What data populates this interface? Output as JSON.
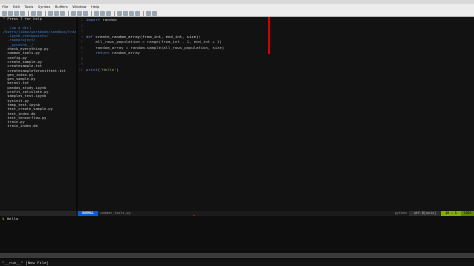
{
  "menubar": {
    "items": [
      "File",
      "Edit",
      "Tools",
      "Syntax",
      "Buffers",
      "Window",
      "Help"
    ]
  },
  "tree": {
    "lines": [
      {
        "text": "\" Press ? for help",
        "kind": "file"
      },
      {
        "text": "",
        "kind": "file"
      },
      {
        "text": ".. (up a dir)",
        "kind": "dir"
      },
      {
        "text": "/Users/jibbo/workbook/sandbox/train/",
        "kind": "root"
      },
      {
        "text": "  .ipynb_checkpoints/",
        "kind": "dir"
      },
      {
        "text": "  .ropeproject/",
        "kind": "dir"
      },
      {
        "text": "  __pycache__/",
        "kind": "dir"
      },
      {
        "text": "  check_everything.py",
        "kind": "file"
      },
      {
        "text": "  common_tools.py",
        "kind": "file"
      },
      {
        "text": "  config.py",
        "kind": "file"
      },
      {
        "text": "  create_sample.py",
        "kind": "file"
      },
      {
        "text": "  createsample.txt",
        "kind": "file"
      },
      {
        "text": "  createsampleforunittest.txt",
        "kind": "file"
      },
      {
        "text": "  gen_index.py",
        "kind": "file"
      },
      {
        "text": "  gen_sample.py",
        "kind": "file"
      },
      {
        "text": "  kerasl.txt",
        "kind": "file"
      },
      {
        "text": "  pandas_study.ipynb",
        "kind": "file"
      },
      {
        "text": "  profit_calculate.py",
        "kind": "file"
      },
      {
        "text": "  samples_test.ipynb",
        "kind": "file"
      },
      {
        "text": "  sysinit.py",
        "kind": "file"
      },
      {
        "text": "  temp_test.ipynb",
        "kind": "file"
      },
      {
        "text": "  test_create_sample.py",
        "kind": "file"
      },
      {
        "text": "  test_index.db",
        "kind": "file"
      },
      {
        "text": "  test_tensorflow.py",
        "kind": "file"
      },
      {
        "text": "  train.py",
        "kind": "file"
      },
      {
        "text": "  train_index.db",
        "kind": "file"
      }
    ]
  },
  "editor": {
    "lines": [
      {
        "n": "1",
        "parts": [
          {
            "t": "import",
            "c": "kw"
          },
          {
            "t": " random",
            "c": "txt"
          }
        ]
      },
      {
        "n": "2",
        "parts": []
      },
      {
        "n": "3",
        "parts": []
      },
      {
        "n": "4",
        "parts": [
          {
            "t": "def",
            "c": "kw"
          },
          {
            "t": " create_random_array(from_int, end_int, size):",
            "c": "fn"
          }
        ]
      },
      {
        "n": "5",
        "parts": [
          {
            "t": "    all_rows_population = range(from_int - 1, end_int + 1)",
            "c": "txt"
          }
        ]
      },
      {
        "n": "6",
        "parts": [
          {
            "t": "    random_array = random.sample(all_rows_population, size)",
            "c": "txt"
          }
        ]
      },
      {
        "n": "7",
        "parts": [
          {
            "t": "    ",
            "c": "txt"
          },
          {
            "t": "return",
            "c": "kw"
          },
          {
            "t": " random_array",
            "c": "txt"
          }
        ]
      },
      {
        "n": "8",
        "parts": []
      },
      {
        "n": "9",
        "parts": []
      },
      {
        "n": "10",
        "parts": [
          {
            "t": "print",
            "c": "kw"
          },
          {
            "t": "(",
            "c": "txt"
          },
          {
            "t": "'Hello'",
            "c": "str"
          },
          {
            "t": ")",
            "c": "txt"
          }
        ]
      }
    ]
  },
  "statusbar": {
    "mode": "NORMAL",
    "file": "common_tools.py",
    "filetype": "python",
    "encoding": "utf-8[unix]",
    "position": "10 : 1",
    "percent": "100%"
  },
  "terminal": {
    "prompt": "$ ",
    "lines": [
      "Hello"
    ]
  },
  "cmdline": {
    "text": "\"__run__\" [New File]"
  },
  "colors": {
    "mode_bg": "#005fd7",
    "pos_bg": "#87af00",
    "colorcolumn": "#d70000"
  }
}
